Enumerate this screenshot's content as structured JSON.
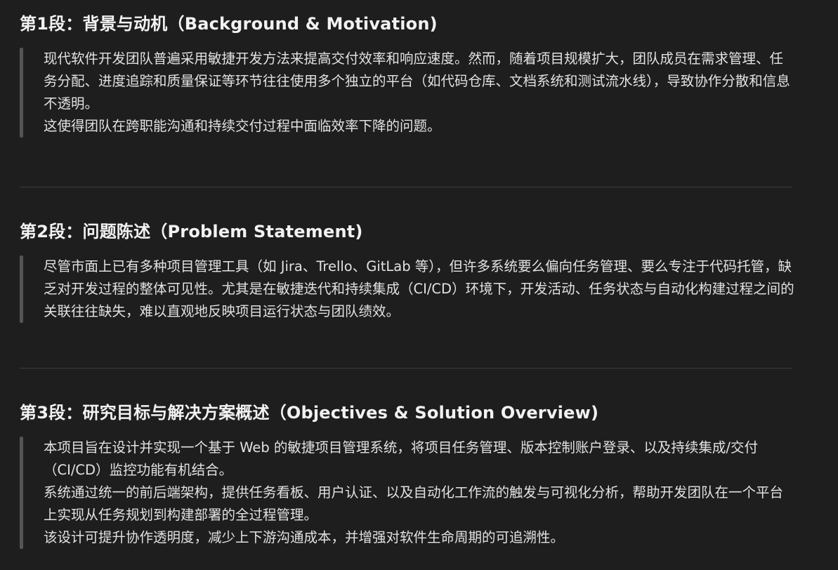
{
  "sections": [
    {
      "heading": "第1段：背景与动机（Background & Motivation)",
      "paragraphs": [
        "现代软件开发团队普遍采用敏捷开发方法来提高交付效率和响应速度。然而，随着项目规模扩大，团队成员在需求管理、任务分配、进度追踪和质量保证等环节往往使用多个独立的平台（如代码仓库、文档系统和测试流水线），导致协作分散和信息不透明。",
        "这使得团队在跨职能沟通和持续交付过程中面临效率下降的问题。"
      ]
    },
    {
      "heading": "第2段：问题陈述（Problem Statement)",
      "paragraphs": [
        "尽管市面上已有多种项目管理工具（如 Jira、Trello、GitLab 等），但许多系统要么偏向任务管理、要么专注于代码托管，缺乏对开发过程的整体可见性。尤其是在敏捷迭代和持续集成（CI/CD）环境下，开发活动、任务状态与自动化构建过程之间的关联往往缺失，难以直观地反映项目运行状态与团队绩效。"
      ]
    },
    {
      "heading": "第3段：研究目标与解决方案概述（Objectives & Solution Overview)",
      "paragraphs": [
        "本项目旨在设计并实现一个基于 Web 的敏捷项目管理系统，将项目任务管理、版本控制账户登录、以及持续集成/交付（CI/CD）监控功能有机结合。",
        "系统通过统一的前后端架构，提供任务看板、用户认证、以及自动化工作流的触发与可视化分析，帮助开发团队在一个平台上实现从任务规划到构建部署的全过程管理。",
        "该设计可提升协作透明度，减少上下游沟通成本，并增强对软件生命周期的可追溯性。"
      ]
    }
  ]
}
